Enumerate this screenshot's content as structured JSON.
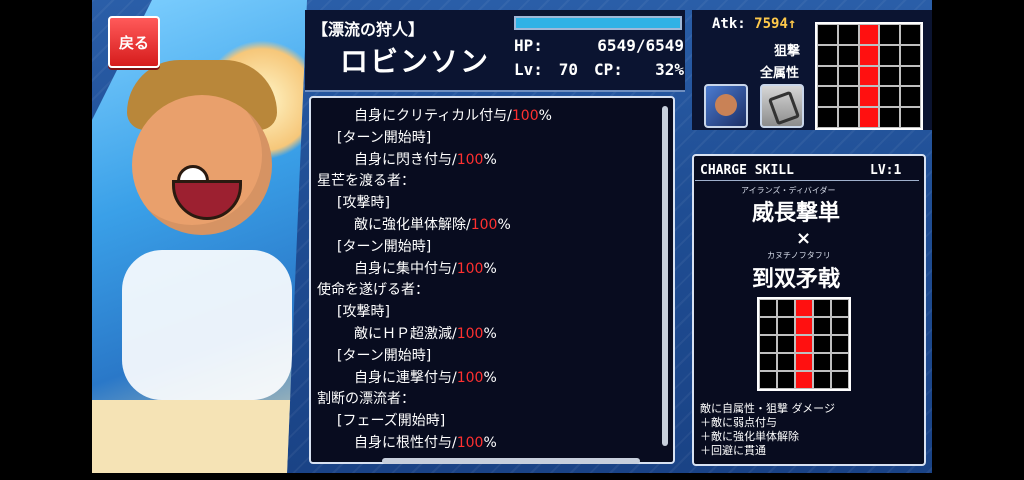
{
  "character": {
    "title": "【漂流の狩人】",
    "name": "ロビンソン",
    "hp_label": "HP:",
    "hp_value": "6549/6549",
    "hp_fill_fraction": 1.0,
    "lv_label": "Lv:",
    "lv_value": "70",
    "cp_label": "CP:",
    "cp_value": "32%",
    "atk_label": "Atk:",
    "atk_value": "7594↑",
    "role": "狙撃",
    "attribute": "全属性"
  },
  "nav": {
    "back_label": "戻る"
  },
  "skills": [
    {
      "text": "自身にクリティカル付与/",
      "value": "100",
      "suffix": "%",
      "indent": 2
    },
    {
      "text": "[ターン開始時]",
      "indent": 1
    },
    {
      "text": "自身に閃き付与/",
      "value": "100",
      "suffix": "%",
      "indent": 2
    },
    {
      "text": "星芒を渡る者：",
      "indent": 0
    },
    {
      "text": "[攻撃時]",
      "indent": 1
    },
    {
      "text": "敵に強化単体解除/",
      "value": "100",
      "suffix": "%",
      "indent": 2
    },
    {
      "text": "[ターン開始時]",
      "indent": 1
    },
    {
      "text": "自身に集中付与/",
      "value": "100",
      "suffix": "%",
      "indent": 2
    },
    {
      "text": "使命を遂げる者：",
      "indent": 0
    },
    {
      "text": "[攻撃時]",
      "indent": 1
    },
    {
      "text": "敵にＨＰ超激減/",
      "value": "100",
      "suffix": "%",
      "indent": 2
    },
    {
      "text": "[ターン開始時]",
      "indent": 1
    },
    {
      "text": "自身に連撃付与/",
      "value": "100",
      "suffix": "%",
      "indent": 2
    },
    {
      "text": "割断の漂流者：",
      "indent": 0
    },
    {
      "text": "[フェーズ開始時]",
      "indent": 1
    },
    {
      "text": "自身に根性付与/",
      "value": "100",
      "suffix": "%",
      "indent": 2
    }
  ],
  "charge_skill": {
    "header": "CHARGE SKILL",
    "level": "LV:1",
    "ruby1": "アイランズ・ディバイダー",
    "name1": "威長撃単",
    "times": "×",
    "ruby2": "カヌチノフタフリ",
    "name2": "到双矛戟",
    "desc": [
      "敵に自属性・狙撃 ダメージ",
      "＋敵に弱点付与",
      "＋敵に強化単体解除",
      "＋回避に貫通"
    ]
  },
  "range_grid": {
    "rows": 5,
    "cols": 5,
    "active_column": 2
  },
  "icons": {
    "character_icon": "character-portrait-icon",
    "weapon_icon": "rifle-weapon-icon"
  },
  "colors": {
    "accent_red": "#ff3030",
    "atk_gold": "#ffc94a",
    "hp_cyan": "#2fb2e6",
    "panel_bg": "#080c1f"
  }
}
